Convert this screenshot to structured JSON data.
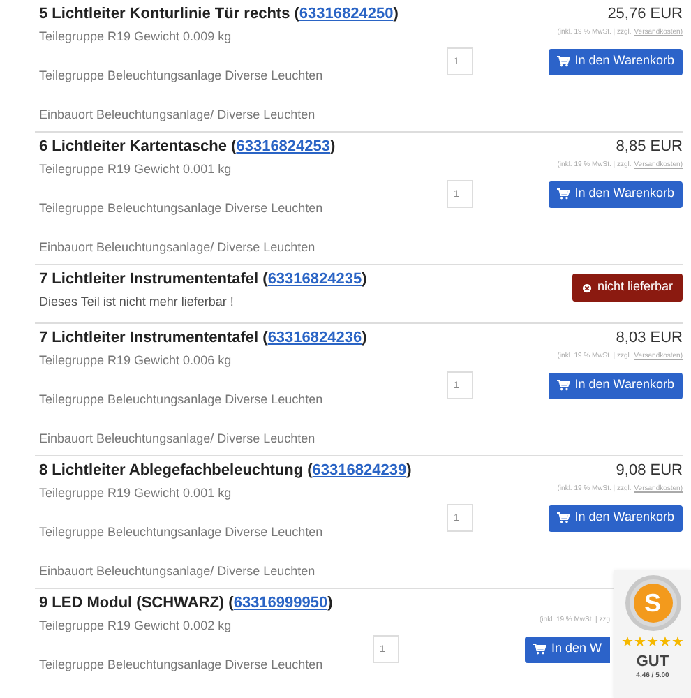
{
  "items": [
    {
      "kind": "available",
      "title": "5 Lichtleiter Konturlinie Tür rechts (",
      "title_end": ")",
      "part_number": "63316824250",
      "lines": [
        "Teilegruppe R19 Gewicht 0.009 kg",
        "Teilegruppe Beleuchtungsanlage Diverse Leuchten",
        "Einbauort Beleuchtungsanlage/ Diverse Leuchten"
      ],
      "price": "25,76 EUR",
      "tax_note": "(inkl. 19 % MwSt. | zzgl.",
      "shipping_link": "Versandkosten)",
      "quantity": "1",
      "button": "In den Warenkorb"
    },
    {
      "kind": "available",
      "title": "6 Lichtleiter Kartentasche (",
      "title_end": ")",
      "part_number": "63316824253",
      "lines": [
        "Teilegruppe R19 Gewicht 0.001 kg",
        "Teilegruppe Beleuchtungsanlage Diverse Leuchten",
        "Einbauort Beleuchtungsanlage/ Diverse Leuchten"
      ],
      "price": "8,85 EUR",
      "tax_note": "(inkl. 19 % MwSt. | zzgl.",
      "shipping_link": "Versandkosten)",
      "quantity": "1",
      "button": "In den Warenkorb"
    },
    {
      "kind": "unavailable",
      "title": "7 Lichtleiter Instrumententafel (",
      "title_end": ")",
      "part_number": "63316824235",
      "lines": [
        "Dieses Teil ist nicht mehr lieferbar !"
      ],
      "button": "nicht lieferbar"
    },
    {
      "kind": "available",
      "title": "7 Lichtleiter Instrumententafel (",
      "title_end": ")",
      "part_number": "63316824236",
      "lines": [
        "Teilegruppe R19 Gewicht 0.006 kg",
        "Teilegruppe Beleuchtungsanlage Diverse Leuchten",
        "Einbauort Beleuchtungsanlage/ Diverse Leuchten"
      ],
      "price": "8,03 EUR",
      "tax_note": "(inkl. 19 % MwSt. | zzgl.",
      "shipping_link": "Versandkosten)",
      "quantity": "1",
      "button": "In den Warenkorb"
    },
    {
      "kind": "available",
      "title": "8 Lichtleiter Ablegefachbeleuchtung (",
      "title_end": ")",
      "part_number": "63316824239",
      "lines": [
        "Teilegruppe R19 Gewicht 0.001 kg",
        "Teilegruppe Beleuchtungsanlage Diverse Leuchten",
        "Einbauort Beleuchtungsanlage/ Diverse Leuchten"
      ],
      "price": "9,08 EUR",
      "tax_note": "(inkl. 19 % MwSt. | zzgl.",
      "shipping_link": "Versandkosten)",
      "quantity": "1",
      "button": "In den Warenkorb"
    },
    {
      "kind": "covered",
      "title": "9 LED Modul (SCHWARZ) (",
      "title_end": ")",
      "part_number": "63316999950",
      "lines": [
        "Teilegruppe R19 Gewicht 0.002 kg",
        "Teilegruppe Beleuchtungsanlage Diverse Leuchten"
      ],
      "tax_note": "(inkl. 19 % MwSt. | zzg",
      "quantity": "1",
      "button": "In den W"
    }
  ],
  "badge": {
    "logo_letter": "S",
    "stars": 5,
    "grade": "GUT",
    "score": "4.46 / 5.00"
  }
}
